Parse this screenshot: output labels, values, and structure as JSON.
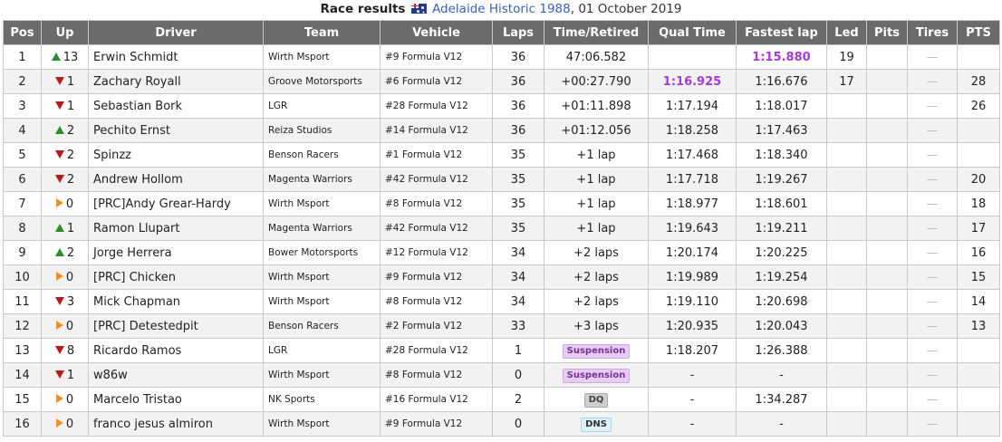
{
  "caption": {
    "title": "Race results",
    "flag_icon": "australia-flag-icon",
    "track": "Adelaide Historic 1988",
    "date": ", 01 October 2019"
  },
  "headers": [
    "Pos",
    "Up",
    "Driver",
    "Team",
    "Vehicle",
    "Laps",
    "Time/Retired",
    "Qual Time",
    "Fastest lap",
    "Led",
    "Pits",
    "Tires",
    "PTS"
  ],
  "colors": {
    "header_bg": "#6b6b6b",
    "up": "#2e8b2e",
    "down": "#b51c1c",
    "same": "#f0902a",
    "best_time": "#a63bd9"
  },
  "rows": [
    {
      "pos": "1",
      "dir": "up",
      "change": "13",
      "driver": "Erwin Schmidt",
      "team": "Wirth Msport",
      "vehicle": "#9 Formula V12",
      "laps": "36",
      "time": "47:06.582",
      "time_badge": "",
      "qual": "",
      "qual_best": false,
      "fastest": "1:15.880",
      "fastest_best": true,
      "led": "19",
      "pits": "",
      "tires": "—",
      "pts": ""
    },
    {
      "pos": "2",
      "dir": "down",
      "change": "1",
      "driver": "Zachary Royall",
      "team": "Groove Motorsports",
      "vehicle": "#6 Formula V12",
      "laps": "36",
      "time": "+00:27.790",
      "time_badge": "",
      "qual": "1:16.925",
      "qual_best": true,
      "fastest": "1:16.676",
      "fastest_best": false,
      "led": "17",
      "pits": "",
      "tires": "—",
      "pts": "28"
    },
    {
      "pos": "3",
      "dir": "down",
      "change": "1",
      "driver": "Sebastian Bork",
      "team": "LGR",
      "vehicle": "#28 Formula V12",
      "laps": "36",
      "time": "+01:11.898",
      "time_badge": "",
      "qual": "1:17.194",
      "qual_best": false,
      "fastest": "1:18.017",
      "fastest_best": false,
      "led": "",
      "pits": "",
      "tires": "—",
      "pts": "26"
    },
    {
      "pos": "4",
      "dir": "up",
      "change": "2",
      "driver": "Pechito Ernst",
      "team": "Reiza Studios",
      "vehicle": "#14 Formula V12",
      "laps": "36",
      "time": "+01:12.056",
      "time_badge": "",
      "qual": "1:18.258",
      "qual_best": false,
      "fastest": "1:17.463",
      "fastest_best": false,
      "led": "",
      "pits": "",
      "tires": "—",
      "pts": ""
    },
    {
      "pos": "5",
      "dir": "down",
      "change": "2",
      "driver": "Spinzz",
      "team": "Benson Racers",
      "vehicle": "#1 Formula V12",
      "laps": "35",
      "time": "+1 lap",
      "time_badge": "",
      "qual": "1:17.468",
      "qual_best": false,
      "fastest": "1:18.340",
      "fastest_best": false,
      "led": "",
      "pits": "",
      "tires": "—",
      "pts": ""
    },
    {
      "pos": "6",
      "dir": "down",
      "change": "2",
      "driver": "Andrew Hollom",
      "team": "Magenta Warriors",
      "vehicle": "#42 Formula V12",
      "laps": "35",
      "time": "+1 lap",
      "time_badge": "",
      "qual": "1:17.718",
      "qual_best": false,
      "fastest": "1:19.267",
      "fastest_best": false,
      "led": "",
      "pits": "",
      "tires": "—",
      "pts": "20"
    },
    {
      "pos": "7",
      "dir": "same",
      "change": "0",
      "driver": "[PRC]Andy Grear-Hardy",
      "team": "Wirth Msport",
      "vehicle": "#8 Formula V12",
      "laps": "35",
      "time": "+1 lap",
      "time_badge": "",
      "qual": "1:18.977",
      "qual_best": false,
      "fastest": "1:18.601",
      "fastest_best": false,
      "led": "",
      "pits": "",
      "tires": "—",
      "pts": "18"
    },
    {
      "pos": "8",
      "dir": "up",
      "change": "1",
      "driver": "Ramon Llupart",
      "team": "Magenta Warriors",
      "vehicle": "#42 Formula V12",
      "laps": "35",
      "time": "+1 lap",
      "time_badge": "",
      "qual": "1:19.643",
      "qual_best": false,
      "fastest": "1:19.211",
      "fastest_best": false,
      "led": "",
      "pits": "",
      "tires": "—",
      "pts": "17"
    },
    {
      "pos": "9",
      "dir": "up",
      "change": "2",
      "driver": "Jorge Herrera",
      "team": "Bower Motorsports",
      "vehicle": "#12 Formula V12",
      "laps": "34",
      "time": "+2 laps",
      "time_badge": "",
      "qual": "1:20.174",
      "qual_best": false,
      "fastest": "1:20.225",
      "fastest_best": false,
      "led": "",
      "pits": "",
      "tires": "—",
      "pts": "16"
    },
    {
      "pos": "10",
      "dir": "same",
      "change": "0",
      "driver": "[PRC] Chicken",
      "team": "Wirth Msport",
      "vehicle": "#9 Formula V12",
      "laps": "34",
      "time": "+2 laps",
      "time_badge": "",
      "qual": "1:19.989",
      "qual_best": false,
      "fastest": "1:19.254",
      "fastest_best": false,
      "led": "",
      "pits": "",
      "tires": "—",
      "pts": "15"
    },
    {
      "pos": "11",
      "dir": "down",
      "change": "3",
      "driver": "Mick Chapman",
      "team": "Wirth Msport",
      "vehicle": "#8 Formula V12",
      "laps": "34",
      "time": "+2 laps",
      "time_badge": "",
      "qual": "1:19.110",
      "qual_best": false,
      "fastest": "1:20.698",
      "fastest_best": false,
      "led": "",
      "pits": "",
      "tires": "—",
      "pts": "14"
    },
    {
      "pos": "12",
      "dir": "same",
      "change": "0",
      "driver": "[PRC] Detestedpit",
      "team": "Benson Racers",
      "vehicle": "#2 Formula V12",
      "laps": "33",
      "time": "+3 laps",
      "time_badge": "",
      "qual": "1:20.935",
      "qual_best": false,
      "fastest": "1:20.043",
      "fastest_best": false,
      "led": "",
      "pits": "",
      "tires": "—",
      "pts": "13"
    },
    {
      "pos": "13",
      "dir": "down",
      "change": "8",
      "driver": "Ricardo Ramos",
      "team": "LGR",
      "vehicle": "#28 Formula V12",
      "laps": "1",
      "time": "Suspension",
      "time_badge": "suspension",
      "qual": "1:18.207",
      "qual_best": false,
      "fastest": "1:26.388",
      "fastest_best": false,
      "led": "",
      "pits": "",
      "tires": "—",
      "pts": ""
    },
    {
      "pos": "14",
      "dir": "down",
      "change": "1",
      "driver": "w86w",
      "team": "Wirth Msport",
      "vehicle": "#8 Formula V12",
      "laps": "0",
      "time": "Suspension",
      "time_badge": "suspension",
      "qual": "-",
      "qual_best": false,
      "fastest": "-",
      "fastest_best": false,
      "led": "",
      "pits": "",
      "tires": "—",
      "pts": ""
    },
    {
      "pos": "15",
      "dir": "same",
      "change": "0",
      "driver": "Marcelo Tristao",
      "team": "NK Sports",
      "vehicle": "#16 Formula V12",
      "laps": "2",
      "time": "DQ",
      "time_badge": "dq",
      "qual": "-",
      "qual_best": false,
      "fastest": "1:34.287",
      "fastest_best": false,
      "led": "",
      "pits": "",
      "tires": "—",
      "pts": ""
    },
    {
      "pos": "16",
      "dir": "same",
      "change": "0",
      "driver": "franco jesus almiron",
      "team": "Wirth Msport",
      "vehicle": "#9 Formula V12",
      "laps": "0",
      "time": "DNS",
      "time_badge": "dns",
      "qual": "-",
      "qual_best": false,
      "fastest": "-",
      "fastest_best": false,
      "led": "",
      "pits": "",
      "tires": "—",
      "pts": ""
    }
  ]
}
